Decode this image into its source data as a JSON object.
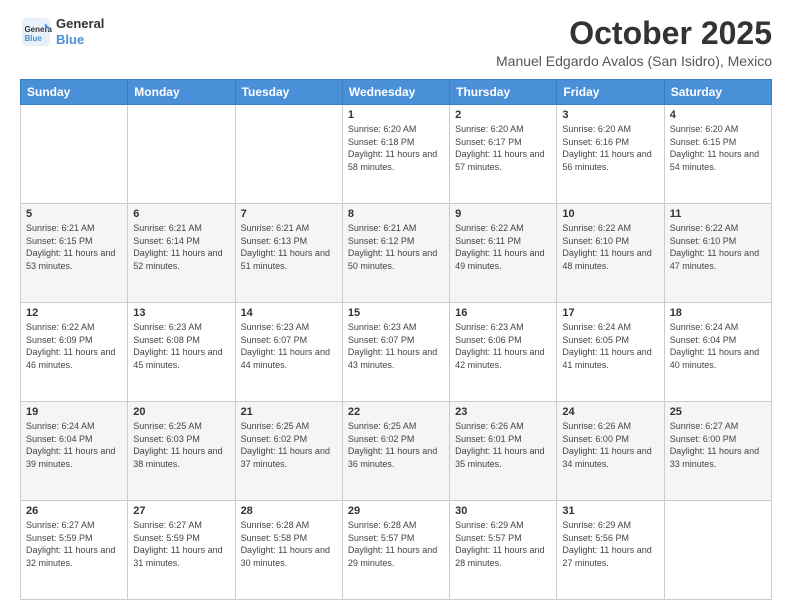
{
  "header": {
    "logo_line1": "General",
    "logo_line2": "Blue",
    "month": "October 2025",
    "location": "Manuel Edgardo Avalos (San Isidro), Mexico"
  },
  "weekdays": [
    "Sunday",
    "Monday",
    "Tuesday",
    "Wednesday",
    "Thursday",
    "Friday",
    "Saturday"
  ],
  "weeks": [
    [
      {
        "day": "",
        "sunrise": "",
        "sunset": "",
        "daylight": ""
      },
      {
        "day": "",
        "sunrise": "",
        "sunset": "",
        "daylight": ""
      },
      {
        "day": "",
        "sunrise": "",
        "sunset": "",
        "daylight": ""
      },
      {
        "day": "1",
        "sunrise": "Sunrise: 6:20 AM",
        "sunset": "Sunset: 6:18 PM",
        "daylight": "Daylight: 11 hours and 58 minutes."
      },
      {
        "day": "2",
        "sunrise": "Sunrise: 6:20 AM",
        "sunset": "Sunset: 6:17 PM",
        "daylight": "Daylight: 11 hours and 57 minutes."
      },
      {
        "day": "3",
        "sunrise": "Sunrise: 6:20 AM",
        "sunset": "Sunset: 6:16 PM",
        "daylight": "Daylight: 11 hours and 56 minutes."
      },
      {
        "day": "4",
        "sunrise": "Sunrise: 6:20 AM",
        "sunset": "Sunset: 6:15 PM",
        "daylight": "Daylight: 11 hours and 54 minutes."
      }
    ],
    [
      {
        "day": "5",
        "sunrise": "Sunrise: 6:21 AM",
        "sunset": "Sunset: 6:15 PM",
        "daylight": "Daylight: 11 hours and 53 minutes."
      },
      {
        "day": "6",
        "sunrise": "Sunrise: 6:21 AM",
        "sunset": "Sunset: 6:14 PM",
        "daylight": "Daylight: 11 hours and 52 minutes."
      },
      {
        "day": "7",
        "sunrise": "Sunrise: 6:21 AM",
        "sunset": "Sunset: 6:13 PM",
        "daylight": "Daylight: 11 hours and 51 minutes."
      },
      {
        "day": "8",
        "sunrise": "Sunrise: 6:21 AM",
        "sunset": "Sunset: 6:12 PM",
        "daylight": "Daylight: 11 hours and 50 minutes."
      },
      {
        "day": "9",
        "sunrise": "Sunrise: 6:22 AM",
        "sunset": "Sunset: 6:11 PM",
        "daylight": "Daylight: 11 hours and 49 minutes."
      },
      {
        "day": "10",
        "sunrise": "Sunrise: 6:22 AM",
        "sunset": "Sunset: 6:10 PM",
        "daylight": "Daylight: 11 hours and 48 minutes."
      },
      {
        "day": "11",
        "sunrise": "Sunrise: 6:22 AM",
        "sunset": "Sunset: 6:10 PM",
        "daylight": "Daylight: 11 hours and 47 minutes."
      }
    ],
    [
      {
        "day": "12",
        "sunrise": "Sunrise: 6:22 AM",
        "sunset": "Sunset: 6:09 PM",
        "daylight": "Daylight: 11 hours and 46 minutes."
      },
      {
        "day": "13",
        "sunrise": "Sunrise: 6:23 AM",
        "sunset": "Sunset: 6:08 PM",
        "daylight": "Daylight: 11 hours and 45 minutes."
      },
      {
        "day": "14",
        "sunrise": "Sunrise: 6:23 AM",
        "sunset": "Sunset: 6:07 PM",
        "daylight": "Daylight: 11 hours and 44 minutes."
      },
      {
        "day": "15",
        "sunrise": "Sunrise: 6:23 AM",
        "sunset": "Sunset: 6:07 PM",
        "daylight": "Daylight: 11 hours and 43 minutes."
      },
      {
        "day": "16",
        "sunrise": "Sunrise: 6:23 AM",
        "sunset": "Sunset: 6:06 PM",
        "daylight": "Daylight: 11 hours and 42 minutes."
      },
      {
        "day": "17",
        "sunrise": "Sunrise: 6:24 AM",
        "sunset": "Sunset: 6:05 PM",
        "daylight": "Daylight: 11 hours and 41 minutes."
      },
      {
        "day": "18",
        "sunrise": "Sunrise: 6:24 AM",
        "sunset": "Sunset: 6:04 PM",
        "daylight": "Daylight: 11 hours and 40 minutes."
      }
    ],
    [
      {
        "day": "19",
        "sunrise": "Sunrise: 6:24 AM",
        "sunset": "Sunset: 6:04 PM",
        "daylight": "Daylight: 11 hours and 39 minutes."
      },
      {
        "day": "20",
        "sunrise": "Sunrise: 6:25 AM",
        "sunset": "Sunset: 6:03 PM",
        "daylight": "Daylight: 11 hours and 38 minutes."
      },
      {
        "day": "21",
        "sunrise": "Sunrise: 6:25 AM",
        "sunset": "Sunset: 6:02 PM",
        "daylight": "Daylight: 11 hours and 37 minutes."
      },
      {
        "day": "22",
        "sunrise": "Sunrise: 6:25 AM",
        "sunset": "Sunset: 6:02 PM",
        "daylight": "Daylight: 11 hours and 36 minutes."
      },
      {
        "day": "23",
        "sunrise": "Sunrise: 6:26 AM",
        "sunset": "Sunset: 6:01 PM",
        "daylight": "Daylight: 11 hours and 35 minutes."
      },
      {
        "day": "24",
        "sunrise": "Sunrise: 6:26 AM",
        "sunset": "Sunset: 6:00 PM",
        "daylight": "Daylight: 11 hours and 34 minutes."
      },
      {
        "day": "25",
        "sunrise": "Sunrise: 6:27 AM",
        "sunset": "Sunset: 6:00 PM",
        "daylight": "Daylight: 11 hours and 33 minutes."
      }
    ],
    [
      {
        "day": "26",
        "sunrise": "Sunrise: 6:27 AM",
        "sunset": "Sunset: 5:59 PM",
        "daylight": "Daylight: 11 hours and 32 minutes."
      },
      {
        "day": "27",
        "sunrise": "Sunrise: 6:27 AM",
        "sunset": "Sunset: 5:59 PM",
        "daylight": "Daylight: 11 hours and 31 minutes."
      },
      {
        "day": "28",
        "sunrise": "Sunrise: 6:28 AM",
        "sunset": "Sunset: 5:58 PM",
        "daylight": "Daylight: 11 hours and 30 minutes."
      },
      {
        "day": "29",
        "sunrise": "Sunrise: 6:28 AM",
        "sunset": "Sunset: 5:57 PM",
        "daylight": "Daylight: 11 hours and 29 minutes."
      },
      {
        "day": "30",
        "sunrise": "Sunrise: 6:29 AM",
        "sunset": "Sunset: 5:57 PM",
        "daylight": "Daylight: 11 hours and 28 minutes."
      },
      {
        "day": "31",
        "sunrise": "Sunrise: 6:29 AM",
        "sunset": "Sunset: 5:56 PM",
        "daylight": "Daylight: 11 hours and 27 minutes."
      },
      {
        "day": "",
        "sunrise": "",
        "sunset": "",
        "daylight": ""
      }
    ]
  ]
}
